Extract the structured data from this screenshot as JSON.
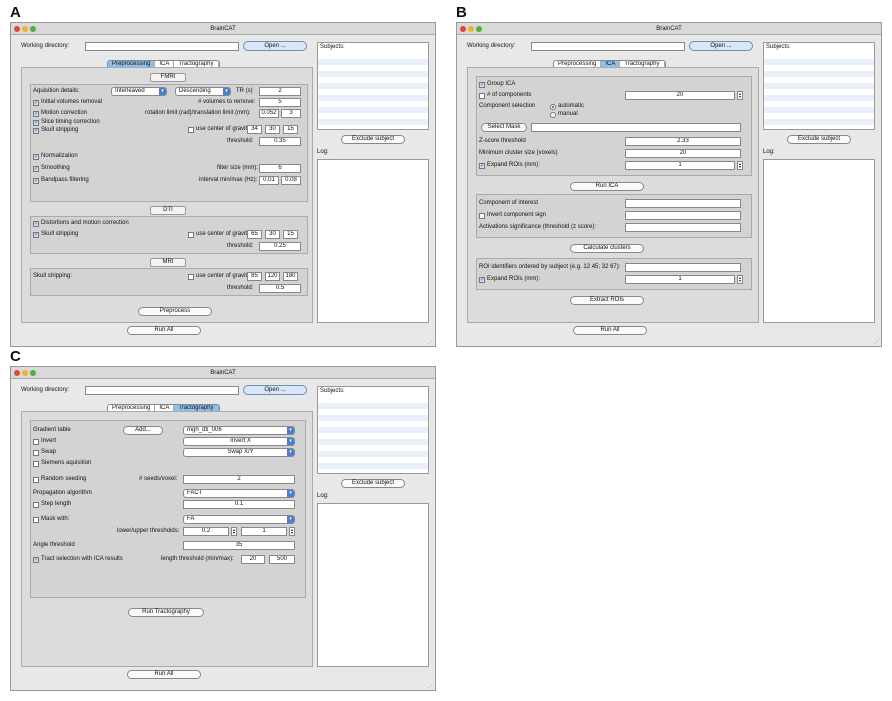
{
  "labels": {
    "a": "A",
    "b": "B",
    "c": "C"
  },
  "app_title": "BrainCAT",
  "common": {
    "working_directory": "Working directory:",
    "open": "Open ...",
    "subjects": "Subjects:",
    "exclude": "Exclude subject",
    "log": "Log:",
    "run_all": "Run All"
  },
  "tabs": {
    "pre": "Preprocessing",
    "ica": "ICA",
    "tract": "Tractography"
  },
  "pre": {
    "fmri": "FMRI",
    "acq": "Aquisition details:",
    "interleaved": "Interleaved",
    "descending": "Descending",
    "tr": "TR (s)",
    "tr_val": "2",
    "init_vol": "Initial volumes removal",
    "nvol": "# volumes to remove:",
    "nvol_val": "5",
    "motion": "Motion correction",
    "rot": "rotation limit (rad)/translation limit (mm):",
    "rot_val": "0.052",
    "trans_val": "3",
    "slice": "Slice timing correction",
    "skull": "Skull stripping",
    "cog": "use center of gravity:",
    "cog1": [
      "34",
      "30",
      "15"
    ],
    "threshold": "threshold:",
    "thr1": "0.35",
    "norm": "Normalization",
    "smooth": "Smoothing",
    "filter": "filter size (mm):",
    "filter_val": "6",
    "bandpass": "Bandpass filtering",
    "interval": "interval  min/max (Hz):",
    "bp_min": "0.01",
    "bp_max": "0.08",
    "dti": "DTI",
    "distort": "Distortions and motion correction",
    "cog2": [
      "65",
      "30",
      "15"
    ],
    "thr2": "0.25",
    "mri": "MRI",
    "skull_mri": "Skull stripping:",
    "cog3": [
      "85",
      "120",
      "180"
    ],
    "thr3": "0.5",
    "preprocess": "Preprocess"
  },
  "ica": {
    "group": "Group ICA",
    "ncomp": "# of components",
    "ncomp_val": "20",
    "compsel": "Component selection",
    "automatic": "automatic",
    "manual": "manual",
    "select_mask": "Select Mask",
    "zscore": "Z-score threshold",
    "zscore_val": "2.33",
    "mincluster": "Minimum cluster size (voxels)",
    "mincluster_val": "20",
    "expand": "Expand ROIs (mm):",
    "expand_val": "1",
    "run_ica": "Run ICA",
    "coi": "Component of interest",
    "invert": "Invert component sign",
    "actsig": "Activations significance (threshold (z score):",
    "calc": "Calculate clusters",
    "roi_ids": "ROI identifiers ordered by subject (e.g. 12 45; 32 67):",
    "expand2_val": "1",
    "extract": "Extract ROIs"
  },
  "tract": {
    "gradient": "Gradient table",
    "add": "Add...",
    "grad_val": "mgh_dti_006",
    "invert": "Invert",
    "invert_val": "Invert X",
    "swap": "Swap",
    "swap_val": "Swap X/Y",
    "siemens": "Siemens aquisition",
    "random": "Random seeding",
    "seeds": "# seeds/voxel:",
    "seeds_val": "2",
    "prop": "Propagation algorithm",
    "prop_val": "FACT",
    "step": "Step length",
    "step_val": "0.1",
    "mask": "Mask with:",
    "mask_val": "FA",
    "lu": "lower/upper thresholds:",
    "lower": "0.2",
    "upper": "1",
    "angle": "Angle threshold",
    "angle_val": "35",
    "tsel": "Tract selection with ICA results",
    "len": "length threshold (min/max):",
    "len_min": "20",
    "len_max": "500",
    "run": "Run Tractography"
  }
}
